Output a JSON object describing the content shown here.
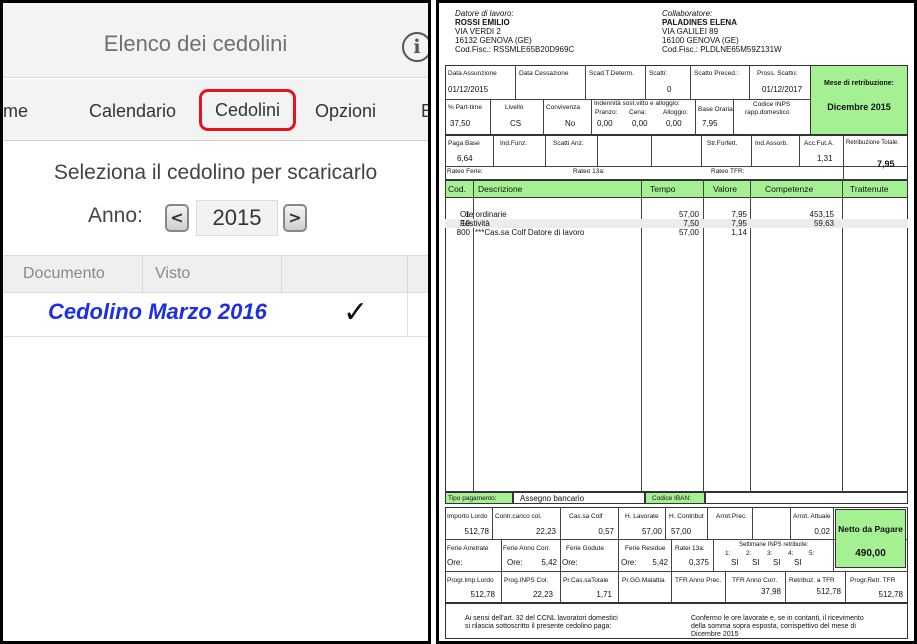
{
  "app": {
    "title": "Elenco dei cedolini",
    "info_icon": "i",
    "tabs": [
      "ome",
      "Calendario",
      "Cedolini",
      "Opzioni",
      "E"
    ],
    "instruction": "Seleziona il cedolino per scaricarlo",
    "year_label": "Anno:",
    "year_prev": "<",
    "year_value": "2015",
    "year_next": ">",
    "columns": [
      "Documento",
      "Visto"
    ],
    "rows": [
      {
        "title": "Cedolino Marzo 2016",
        "visto": "✓"
      }
    ],
    "accent_color": "#e2141c",
    "link_color": "#1c2ee6"
  },
  "payslip": {
    "employer": {
      "label": "Datore di lavoro:",
      "name": "ROSSI EMILIO",
      "address": "VIA VERDI 2",
      "city": "16132 GENOVA (GE)",
      "fiscal": "Cod.Fisc.: RSSMLE65B20D969C"
    },
    "worker": {
      "label": "Collaboratore:",
      "name": "PALADINES ELENA",
      "address": "VIA GALILEI 89",
      "city": "16100 GENOVA (GE)",
      "fiscal": "Cod.Fisc.: PLDLNE65M59Z131W"
    },
    "info1": {
      "assunzione_l": "Data Assunzione",
      "assunzione_v": "01/12/2015",
      "cessazione_l": "Data Cessazione",
      "cessazione_v": "",
      "scad_l": "Scad.T.Determ.",
      "scad_v": "",
      "scatti_l": "Scatti:",
      "scatti_v": "0",
      "scatto_prec_l": "Scatto Preced.:",
      "scatto_prec_v": "",
      "pross_l": "Pross. Scatto:",
      "pross_v": "01/12/2017"
    },
    "month": {
      "label": "Mese di retribuzione:",
      "value": "Dicembre 2015"
    },
    "info2": {
      "parttime_l": "% Part-time",
      "parttime_v": "37,50",
      "livello_l": "Livello",
      "livello_v": "CS",
      "convivenza_l": "Convivenza",
      "convivenza_v": "No",
      "indennita_l": "Indennità sost.vitto e alloggio:",
      "pranzo_l": "Pranzo:",
      "pranzo_v": "0,00",
      "cena_l": "Cena:",
      "cena_v": "0,00",
      "alloggio_l": "Alloggio:",
      "alloggio_v": "0,00",
      "base_l": "Base Oraria",
      "base_v": "7,95",
      "inps_l": "Codice INPS",
      "inps_sub": "rapp.domestico",
      "inps_v": ""
    },
    "info3": {
      "paga_l": "Paga Base",
      "paga_v": "6,64",
      "ind_funz_l": "Ind.Funz.",
      "ind_funz_v": "",
      "scatti_anz_l": "Scatti Anz.",
      "scatti_anz_v": "",
      "str_l": "Str.Forfett.",
      "str_v": "",
      "ind_ass_l": "Ind.Assorb.",
      "ind_ass_v": "",
      "acc_l": "Acc.Fut.A.",
      "acc_v": "1,31",
      "retr_l": "Retribuzione Totale:",
      "retr_v": "7,95",
      "rateo_ferie_l": "Rateo Ferie:",
      "rateo_13_l": "Rateo 13a:",
      "rateo_tfr_l": "Rateo TFR:"
    },
    "table": {
      "headers": [
        "Cod.",
        "Descrizione",
        "Tempo",
        "Valore",
        "Competenze",
        "Trattenute"
      ],
      "rows": [
        {
          "cod": "1",
          "desc": "Ore ordinarie",
          "tempo": "57,00",
          "valore": "7,95",
          "comp": "453,15",
          "tratt": ""
        },
        {
          "cod": "10",
          "desc": "Festività",
          "tempo": "7,50",
          "valore": "7,95",
          "comp": "59,63",
          "tratt": ""
        },
        {
          "cod": "800",
          "desc": "***Cas.sa Colf Datore di lavoro",
          "tempo": "57,00",
          "valore": "1,14",
          "comp": "",
          "tratt": ""
        }
      ]
    },
    "payment": {
      "tipo_l": "Tipo pagamento:",
      "tipo_v": "Assegno bancario",
      "iban_l": "Codice IBAN:",
      "iban_v": ""
    },
    "totals1": {
      "lordo_l": "Importo Lordo",
      "lordo_v": "512,78",
      "contr_l": "Contr.carico col.",
      "contr_v": "22,23",
      "cassa_l": "Cas.sa Colf",
      "cassa_v": "0,57",
      "hlav_l": "H. Lavorate",
      "hlav_v": "57,00",
      "hcontr_l": "H. Contribut",
      "hcontr_v": "57,00",
      "arrprec_l": "Arrot.Prec.",
      "arrprec_v": "",
      "arratt_l": "Arrot. Attuale",
      "arratt_v": "0,02"
    },
    "netto": {
      "label": "Netto da Pagare",
      "value": "490,00"
    },
    "totals2": {
      "ferie_arr_l": "Ferie Arretrate",
      "ferie_arr_v": "Ore:",
      "ferie_corr_l": "Ferie Anno Corr.",
      "ferie_corr_o": "Ore:",
      "ferie_corr_v": "5,42",
      "ferie_god_l": "Ferie Godute",
      "ferie_god_v": "Ore:",
      "ferie_res_l": "Ferie Residue",
      "ferie_res_o": "Ore:",
      "ferie_res_v": "5,42",
      "ratei_l": "Ratei 13a:",
      "ratei_v": "0,375",
      "sett_l": "Settimane INPS retribuite:",
      "weeks": [
        "1:",
        "2:",
        "3:",
        "4:",
        "5:"
      ],
      "weeks_v": [
        "SI",
        "SI",
        "SI",
        "SI",
        ""
      ]
    },
    "totals3": {
      "prog_lordo_l": "Progr.Imp.Lordo",
      "prog_lordo_v": "512,78",
      "prog_inps_l": "Prog.INPS Col.",
      "prog_inps_v": "22,23",
      "pr_cassa_l": "Pr.Cas.saTotale",
      "pr_cassa_v": "1,71",
      "pr_gg_l": "Pr.GG.Malattia",
      "pr_gg_v": "",
      "tfr_prec_l": "TFR Anno Prec.",
      "tfr_prec_v": "",
      "tfr_corr_l": "TFR Anno Corr.",
      "tfr_corr_v": "37,98",
      "retr_tfr_l": "Retribuz. a TFR",
      "retr_tfr_v": "512,78",
      "prog_retr_l": "Progr.Retr. TFR",
      "prog_retr_v": "512,78"
    },
    "footer": {
      "left": [
        "Ai sensi dell'art. 32 del CCNL lavoratori domestici",
        "si rilascia sottoscritto il presente cedolino paga:"
      ],
      "right": [
        "Confermo le ore lavorate e, se in contanti, il ricevimento",
        "della somma sopra esposta, corrispettivo del mese di",
        "Dicembre 2015"
      ]
    },
    "green_color": "#a6f094"
  }
}
